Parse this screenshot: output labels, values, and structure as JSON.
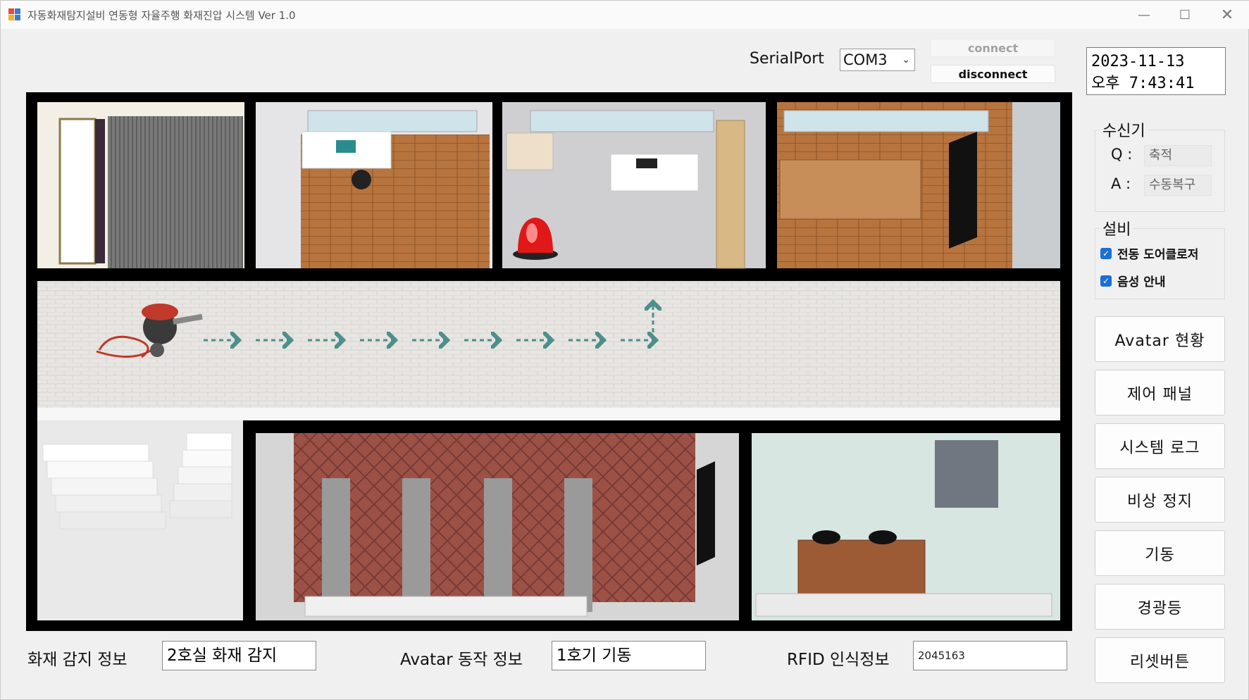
{
  "window": {
    "title": "자동화재탐지설비 연동형 자율주행 화재진압 시스템 Ver 1.0"
  },
  "serial": {
    "label": "SerialPort",
    "port": "COM3",
    "connect_label": "connect",
    "disconnect_label": "disconnect"
  },
  "datetime": {
    "date": "2023-11-13",
    "time": "오후 7:43:41"
  },
  "receiver": {
    "title": "수신기",
    "q_label": "Q :",
    "q_value": "축적",
    "a_label": "A :",
    "a_value": "수동복구"
  },
  "equipment": {
    "title": "설비",
    "items": [
      {
        "label": "전동 도어클로저",
        "checked": true
      },
      {
        "label": "음성 안내",
        "checked": true
      }
    ]
  },
  "side_buttons": [
    "Avatar 현황",
    "제어 패널",
    "시스템 로그",
    "비상 정지",
    "기동",
    "경광등",
    "리셋버튼"
  ],
  "status": {
    "fire_label": "화재 감지 정보",
    "fire_value": "2호실 화재 감지",
    "avatar_label": "Avatar 동작 정보",
    "avatar_value": "1호기 기동",
    "rfid_label": "RFID 인식정보",
    "rfid_value": "2045163"
  },
  "colors": {
    "accent_check": "#1a6fd8",
    "path_arrow": "#4d8f8a",
    "beacon": "#e01818"
  }
}
